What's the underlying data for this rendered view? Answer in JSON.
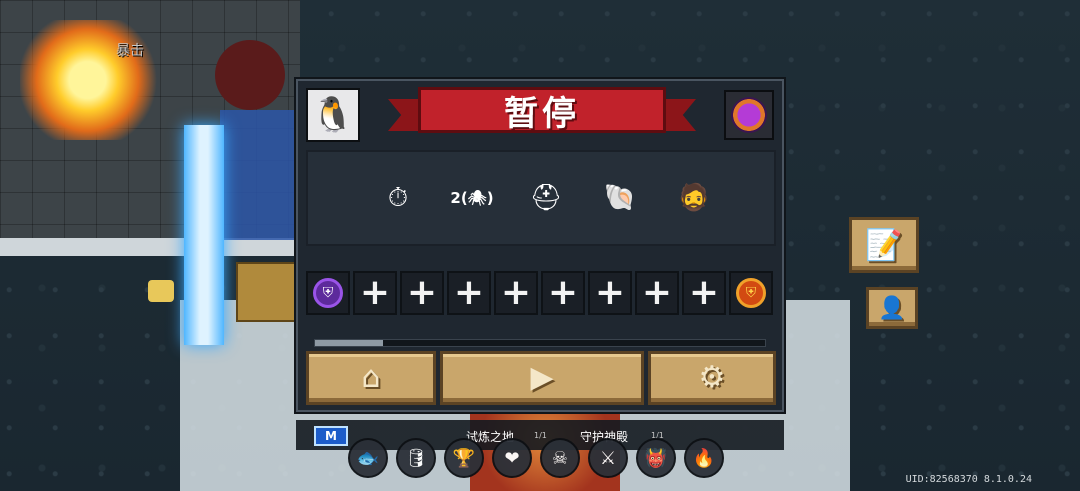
{
  "scene": {
    "crit_label": "暴击"
  },
  "pause_menu": {
    "title": "暂停",
    "buffs": [
      {
        "icon": "green-arrows-clock-icon",
        "glyph": "⏱"
      },
      {
        "icon": "spider-skull-icon",
        "label": "2(🕷)"
      },
      {
        "icon": "golden-helmet-icon",
        "glyph": "⛑"
      },
      {
        "icon": "blue-wave-shell-icon",
        "glyph": "🐚"
      },
      {
        "icon": "hero-portrait-icon",
        "glyph": "🧔"
      }
    ],
    "slots": {
      "left_icon": "purple-shield-icon",
      "right_icon": "orange-shield-icon",
      "empty_count": 9,
      "plus_glyph": "+"
    },
    "progress": 0.15,
    "buttons": {
      "home": "⌂",
      "play": "▶",
      "settings": "⚙"
    }
  },
  "info_bar": {
    "mode_badge": "M",
    "levels": [
      {
        "name": "试炼之地",
        "count": "1/1"
      },
      {
        "name": "守护神殿",
        "count": "1/1"
      }
    ]
  },
  "skills": [
    {
      "icon": "fish-skill-icon",
      "glyph": "🐟"
    },
    {
      "icon": "barrel-skill-icon",
      "glyph": "🛢"
    },
    {
      "icon": "trophy-skill-icon",
      "glyph": "🏆"
    },
    {
      "icon": "heart-skill-icon",
      "glyph": "❤"
    },
    {
      "icon": "poison-skill-icon",
      "glyph": "☠"
    },
    {
      "icon": "crossed-weapons-skill-icon",
      "glyph": "⚔"
    },
    {
      "icon": "demon-skill-icon",
      "glyph": "👹"
    },
    {
      "icon": "torch-skill-icon",
      "glyph": "🔥"
    }
  ],
  "side_buttons": {
    "notes": "📝",
    "profile": "👤"
  },
  "footer": {
    "uid": "UID:82568370 8.1.0.24"
  },
  "colors": {
    "banner_red": "#c1222b",
    "button_tan": "#c9a66b",
    "panel_bg": "#1f2730"
  }
}
